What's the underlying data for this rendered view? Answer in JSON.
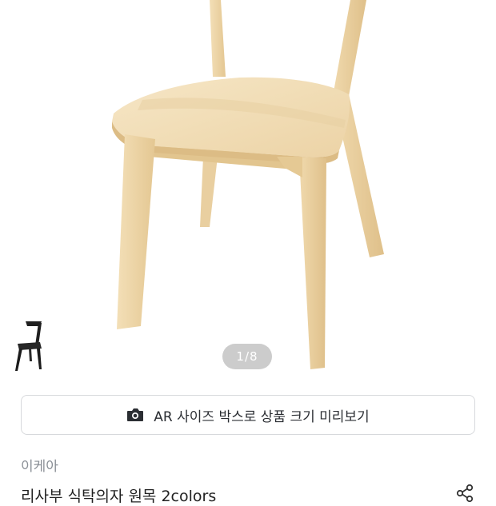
{
  "gallery": {
    "page_indicator": "1/8",
    "image_alt": "chair-photo",
    "variant_thumbnail": "black-chair-variant"
  },
  "ar_button": {
    "icon": "camera-icon",
    "label": "AR 사이즈 박스로 상품 크기 미리보기"
  },
  "product": {
    "brand": "이케아",
    "title": "리사부 식탁의자 원목 2colors"
  },
  "colors": {
    "wood": "#efd7ad",
    "text_muted": "#8a8f96",
    "border": "#d7d9dc"
  }
}
